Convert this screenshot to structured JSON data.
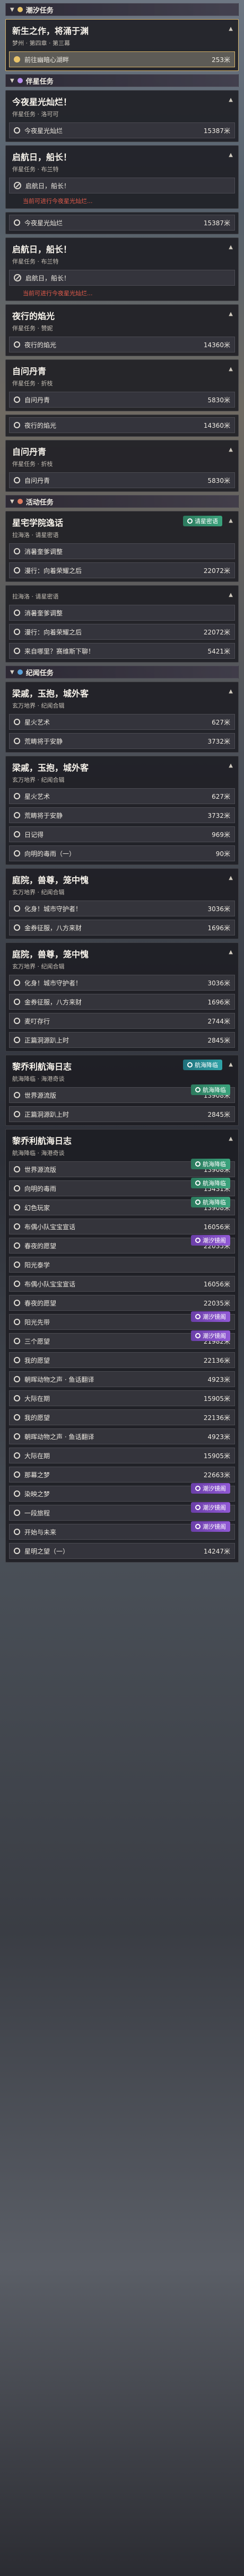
{
  "sections": [
    {
      "type": "head",
      "title": "潮汐任务",
      "color": "#e9c46a"
    },
    {
      "type": "card",
      "gold": true,
      "title": "新生之作，将涌于渊",
      "sub": "梦州 · 第四章 · 第三幕",
      "objectives": [
        {
          "label": "前往幽暗心湖畔",
          "dist": "253米",
          "active": true
        }
      ]
    },
    {
      "type": "head",
      "title": "伴星任务",
      "color": "#b78df0"
    },
    {
      "type": "card",
      "title": "今夜星光灿烂！",
      "sub": "伴星任务 · 洛可可",
      "objectives": [
        {
          "label": "今夜星光灿烂",
          "dist": "15387米"
        }
      ]
    },
    {
      "type": "card",
      "title": "启航日，船长！",
      "sub": "伴星任务 · 布兰特",
      "objectives": [
        {
          "label": "启航日，船长！",
          "dist": "",
          "blocked": true
        }
      ],
      "warn": "当前可进行今夜星光灿烂..."
    },
    {
      "type": "card",
      "title": "",
      "sub": "",
      "objectives": [
        {
          "label": "今夜星光灿烂",
          "dist": "15387米"
        }
      ]
    },
    {
      "type": "card",
      "title": "启航日，船长！",
      "sub": "伴星任务 · 布兰特",
      "objectives": [
        {
          "label": "启航日，船长！",
          "dist": "",
          "blocked": true
        }
      ],
      "warn": "当前可进行今夜星光灿烂..."
    },
    {
      "type": "card",
      "title": "夜行的焰光",
      "sub": "伴星任务 · 赞妮",
      "objectives": [
        {
          "label": "夜行的焰光",
          "dist": "14360米"
        }
      ]
    },
    {
      "type": "card",
      "title": "自问丹青",
      "sub": "伴星任务 · 折枝",
      "objectives": [
        {
          "label": "自问丹青",
          "dist": "5830米"
        }
      ]
    },
    {
      "type": "card",
      "title": "",
      "sub": "",
      "objectives": [
        {
          "label": "夜行的焰光",
          "dist": "14360米"
        }
      ]
    },
    {
      "type": "card",
      "title": "自问丹青",
      "sub": "伴星任务 · 折枝",
      "objectives": [
        {
          "label": "自问丹青",
          "dist": "5830米"
        }
      ]
    },
    {
      "type": "head",
      "title": "活动任务",
      "color": "#e07a5f"
    },
    {
      "type": "card",
      "title": "星宅学院逸话",
      "sub": "拉海洛 · 请星密语",
      "badge": "请星密语",
      "objectives": [
        {
          "label": "消暑奎爹调整",
          "dist": ""
        },
        {
          "label": "漫行：向着荣耀之后",
          "dist": "22072米"
        }
      ]
    },
    {
      "type": "card",
      "title": "",
      "sub": "拉海洛 · 请星密语",
      "objectives": [
        {
          "label": "消暑奎爹调整",
          "dist": ""
        },
        {
          "label": "漫行：向着荣耀之后",
          "dist": "22072米"
        },
        {
          "label": "来自哪里？赛维斯下聊！",
          "dist": "5421米"
        }
      ]
    },
    {
      "type": "head",
      "title": "纪闻任务",
      "color": "#5aa0d8"
    },
    {
      "type": "card",
      "title": "梁戚，玉抱，城外客",
      "sub": "玄万地界 · 纪闻合辑",
      "objectives": [
        {
          "label": "星火艺术",
          "dist": "627米"
        },
        {
          "label": "荒畴将于安静",
          "dist": "3732米"
        }
      ]
    },
    {
      "type": "card",
      "title": "梁戚，玉抱，城外客",
      "sub": "玄万地界 · 纪闻合辑",
      "objectives": [
        {
          "label": "星火艺术",
          "dist": "627米"
        },
        {
          "label": "荒畴将于安静",
          "dist": "3732米"
        },
        {
          "label": "日记得",
          "dist": "969米"
        },
        {
          "label": "向明的毒雨（一）",
          "dist": "90米"
        }
      ]
    },
    {
      "type": "card",
      "title": "庭院，兽尊，笼中愧",
      "sub": "玄万地界 · 纪闻合辑",
      "objectives": [
        {
          "label": "化身！城市守护者！",
          "dist": "3036米"
        },
        {
          "label": "金券征服，八方来财",
          "dist": "1696米"
        }
      ]
    },
    {
      "type": "card",
      "title": "庭院，兽尊，笼中愧",
      "sub": "玄万地界 · 纪闻合辑",
      "objectives": [
        {
          "label": "化身！城市守护者！",
          "dist": "3036米"
        },
        {
          "label": "金券征服，八方来财",
          "dist": "1696米"
        },
        {
          "label": "麦叮存行",
          "dist": "2744米"
        },
        {
          "label": "正篇洞源趴上时",
          "dist": "2845米"
        }
      ]
    },
    {
      "type": "card",
      "title": "黎乔利航海日志",
      "sub": "航海降临 · 海港奇谈",
      "badge": "航海降临",
      "badgeColor": "teal",
      "objectives": [
        {
          "label": "世界源流版",
          "dist": "13908米",
          "badge": "航海降临"
        },
        {
          "label": "正篇洞源趴上时",
          "dist": "2845米"
        }
      ]
    },
    {
      "type": "card",
      "title": "黎乔利航海日志",
      "sub": "航海降临 · 海港奇谈",
      "objectives": [
        {
          "label": "世界源流版",
          "dist": "13908米",
          "badge": "航海降临"
        },
        {
          "label": "向明的毒雨",
          "dist": "15431米",
          "badge": "航海降临"
        },
        {
          "label": "幻色玩家",
          "dist": "13908米",
          "badge": "航海降临"
        },
        {
          "label": "布偶小队宝宝宣话",
          "dist": "16056米"
        },
        {
          "label": "春夜的愿望",
          "dist": "22035米",
          "badge": "潮汐镜阁",
          "badgeColor": "purple"
        },
        {
          "label": "阳光泰学",
          "dist": ""
        },
        {
          "label": "布偶小队宝宝宣话",
          "dist": "16056米"
        },
        {
          "label": "春夜的愿望",
          "dist": "22035米"
        },
        {
          "label": "阳光先带",
          "dist": "",
          "badge": "潮汐镜阁",
          "badgeColor": "purple"
        },
        {
          "label": "三个愿望",
          "dist": "21982米",
          "badge": "潮汐镜阁",
          "badgeColor": "purple"
        },
        {
          "label": "我的愿望",
          "dist": "22136米"
        },
        {
          "label": "朝晖动物之声 · 鱼话翻译",
          "dist": "4923米"
        },
        {
          "label": "大际在期",
          "dist": "15905米"
        },
        {
          "label": "我的愿望",
          "dist": "22136米"
        },
        {
          "label": "朝晖动物之声 · 鱼话翻译",
          "dist": "4923米"
        },
        {
          "label": "大际在期",
          "dist": "15905米"
        },
        {
          "label": "那幕之梦",
          "dist": "22663米"
        },
        {
          "label": "染映之梦",
          "dist": "",
          "badge": "潮汐镜阁",
          "badgeColor": "purple"
        },
        {
          "label": "一段旅程",
          "dist": "",
          "badge": "潮汐镜阁",
          "badgeColor": "purple"
        },
        {
          "label": "开始与未来",
          "dist": "",
          "badge": "潮汐镜阁",
          "badgeColor": "purple"
        },
        {
          "label": "星明之望（一）",
          "dist": "14247米"
        }
      ]
    }
  ]
}
